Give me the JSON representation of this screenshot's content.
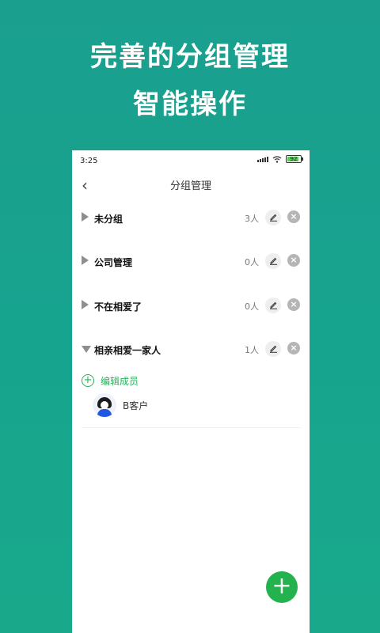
{
  "promo": {
    "headline_line1": "完善的分组管理",
    "headline_line2": "智能操作"
  },
  "status_bar": {
    "time": "3:25",
    "battery_level": "92",
    "icons": [
      "signal-icon",
      "wifi-icon",
      "battery-icon"
    ]
  },
  "navbar": {
    "back_icon": "‹",
    "title": "分组管理"
  },
  "groups": [
    {
      "name": "未分组",
      "count": "3人",
      "expanded": false
    },
    {
      "name": "公司管理",
      "count": "0人",
      "expanded": false
    },
    {
      "name": "不在相爱了",
      "count": "0人",
      "expanded": false
    },
    {
      "name": "相亲相爱一家人",
      "count": "1人",
      "expanded": true
    }
  ],
  "expanded_group": {
    "edit_members_label": "编辑成员",
    "members": [
      {
        "name": "B客户"
      }
    ]
  },
  "fab": {
    "icon": "+"
  },
  "colors": {
    "background": "#1a9f8e",
    "accent_green": "#23b24e",
    "member_avatar_body": "#1f57e0"
  }
}
